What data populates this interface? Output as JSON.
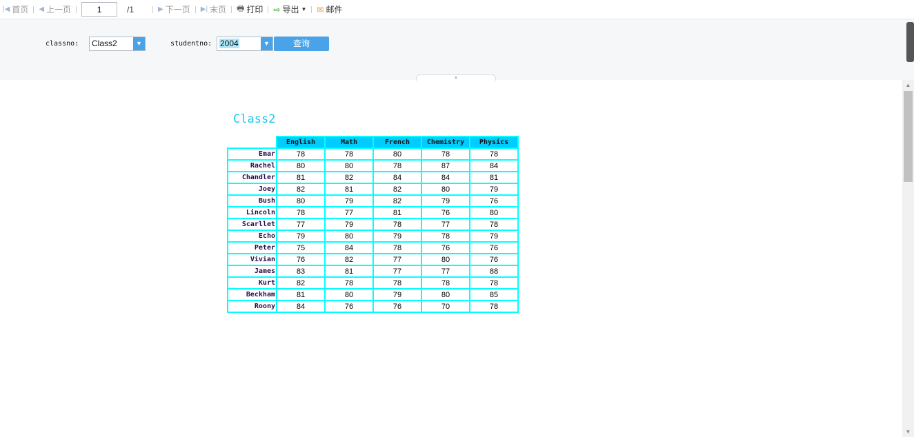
{
  "toolbar": {
    "first": "首页",
    "prev": "上一页",
    "page": "1",
    "total": "/1",
    "next": "下一页",
    "last": "末页",
    "print": "打印",
    "export": "导出",
    "mail": "邮件"
  },
  "filter": {
    "classno_label": "classno:",
    "classno_value": "Class2",
    "studentno_label": "studentno:",
    "studentno_value": "2004",
    "query": "查询"
  },
  "report": {
    "title": "Class2",
    "headers": [
      "English",
      "Math",
      "French",
      "Chemistry",
      "Physics"
    ],
    "rows": [
      {
        "name": "Emar",
        "scores": [
          78,
          78,
          80,
          78,
          78
        ]
      },
      {
        "name": "Rachel",
        "scores": [
          80,
          80,
          78,
          87,
          84
        ]
      },
      {
        "name": "Chandler",
        "scores": [
          81,
          82,
          84,
          84,
          81
        ]
      },
      {
        "name": "Joey",
        "scores": [
          82,
          81,
          82,
          80,
          79
        ]
      },
      {
        "name": "Bush",
        "scores": [
          80,
          79,
          82,
          79,
          76
        ]
      },
      {
        "name": "Lincoln",
        "scores": [
          78,
          77,
          81,
          76,
          80
        ]
      },
      {
        "name": "Scarllet",
        "scores": [
          77,
          79,
          78,
          77,
          78
        ]
      },
      {
        "name": "Echo",
        "scores": [
          79,
          80,
          79,
          78,
          79
        ]
      },
      {
        "name": "Peter",
        "scores": [
          75,
          84,
          78,
          76,
          76
        ]
      },
      {
        "name": "Vivian",
        "scores": [
          76,
          82,
          77,
          80,
          76
        ]
      },
      {
        "name": "James",
        "scores": [
          83,
          81,
          77,
          77,
          88
        ]
      },
      {
        "name": "Kurt",
        "scores": [
          82,
          78,
          78,
          78,
          78
        ]
      },
      {
        "name": "Beckham",
        "scores": [
          81,
          80,
          79,
          80,
          85
        ]
      },
      {
        "name": "Roony",
        "scores": [
          84,
          76,
          76,
          70,
          78
        ]
      }
    ]
  }
}
